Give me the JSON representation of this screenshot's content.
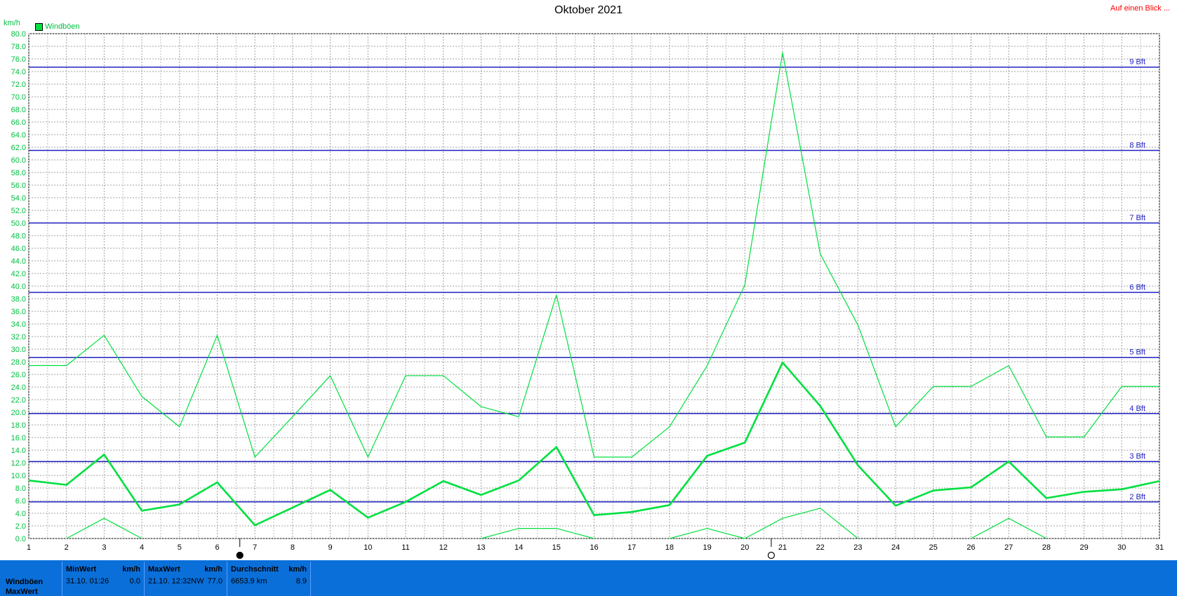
{
  "header": {
    "title": "Oktober 2021",
    "link_label": "Auf einen Blick ..."
  },
  "unit_label": "km/h",
  "legend": {
    "label": "Windböen"
  },
  "colors": {
    "series": "#00e040",
    "beaufort": "#2020c0",
    "grid": "#a0a0a0",
    "axis_text": "#00c040"
  },
  "chart_data": {
    "type": "line",
    "title": "Oktober 2021",
    "ylabel": "km/h",
    "x": [
      1,
      2,
      3,
      4,
      5,
      6,
      7,
      8,
      9,
      10,
      11,
      12,
      13,
      14,
      15,
      16,
      17,
      18,
      19,
      20,
      21,
      22,
      23,
      24,
      25,
      26,
      27,
      28,
      29,
      30,
      31
    ],
    "xlim": [
      1,
      31
    ],
    "ylim": [
      0,
      80
    ],
    "ytick_step": 2,
    "grid": true,
    "legend_position": "top-left",
    "series": [
      {
        "name": "Windböen",
        "role": "max",
        "values": [
          27.4,
          27.4,
          32.2,
          22.5,
          17.7,
          32.2,
          12.9,
          19.3,
          25.8,
          12.9,
          25.8,
          25.8,
          20.9,
          19.3,
          38.6,
          12.9,
          12.9,
          17.7,
          27.4,
          40.2,
          77.0,
          45.1,
          33.8,
          17.7,
          24.1,
          24.1,
          27.4,
          16.1,
          16.1,
          24.1,
          24.1
        ]
      },
      {
        "role": "mean",
        "values": [
          9.2,
          8.5,
          13.3,
          4.4,
          5.4,
          8.9,
          2.1,
          4.9,
          7.7,
          3.3,
          5.8,
          9.1,
          6.9,
          9.2,
          14.5,
          3.7,
          4.2,
          5.3,
          13.1,
          15.2,
          27.9,
          21.0,
          11.6,
          5.2,
          7.6,
          8.1,
          12.2,
          6.4,
          7.4,
          7.8,
          9.1
        ]
      },
      {
        "role": "min",
        "values": [
          null,
          0,
          3.2,
          0,
          null,
          null,
          null,
          null,
          null,
          null,
          null,
          null,
          0,
          1.6,
          1.6,
          0,
          null,
          0,
          1.6,
          0,
          3.2,
          4.8,
          0,
          null,
          null,
          0,
          3.2,
          0,
          null,
          null,
          null
        ]
      }
    ],
    "reference_lines": [
      {
        "label": "2 Bft",
        "y": 5.8
      },
      {
        "label": "3 Bft",
        "y": 12.2
      },
      {
        "label": "4 Bft",
        "y": 19.8
      },
      {
        "label": "5 Bft",
        "y": 28.7
      },
      {
        "label": "6 Bft",
        "y": 39.0
      },
      {
        "label": "7 Bft",
        "y": 50.0
      },
      {
        "label": "8 Bft",
        "y": 61.5
      },
      {
        "label": "9 Bft",
        "y": 74.7
      }
    ],
    "markers": [
      {
        "icon": "new-moon-icon",
        "x": 6.6
      },
      {
        "icon": "full-moon-icon",
        "x": 20.7
      }
    ]
  },
  "footer": {
    "row_labels": [
      "Windböen",
      "MaxWert"
    ],
    "panels": [
      {
        "head_left": "MinWert",
        "head_right": "km/h",
        "val_left": "31.10.  01:26",
        "val_right": "0.0"
      },
      {
        "head_left": "MaxWert",
        "head_right": "km/h",
        "val_left": "21.10.  12:32NW",
        "val_right": "77.0"
      },
      {
        "head_left": "Durchschnitt",
        "head_right": "km/h",
        "val_left": "6653.9 km",
        "val_right": "8.9"
      }
    ]
  }
}
